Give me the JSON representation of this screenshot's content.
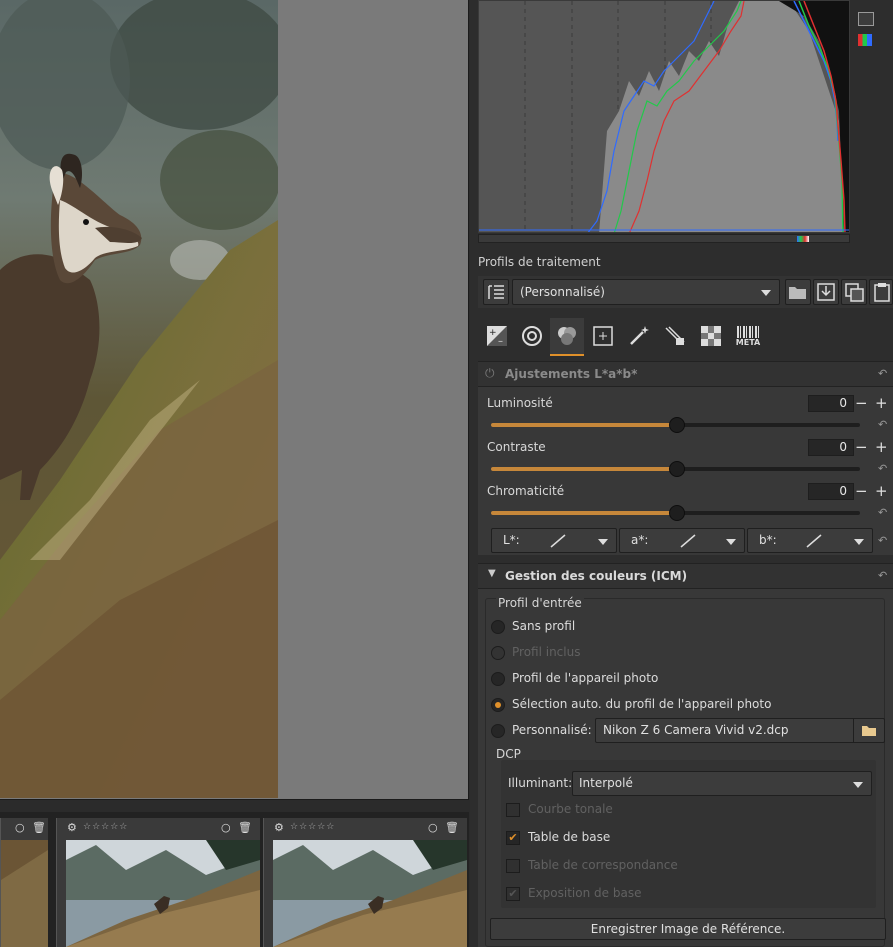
{
  "processing_profiles": {
    "label": "Profils de traitement",
    "selected": "(Personnalisé)"
  },
  "tabs": [
    {
      "name": "exposure-tab",
      "icon": "exposure-icon"
    },
    {
      "name": "detail-tab",
      "icon": "aperture-icon"
    },
    {
      "name": "color-tab",
      "icon": "color-circles-icon",
      "active": true
    },
    {
      "name": "advanced-tab",
      "icon": "crosshair-icon"
    },
    {
      "name": "transform-tab",
      "icon": "magic-wand-icon"
    },
    {
      "name": "raw-tab",
      "icon": "raw-icon"
    },
    {
      "name": "locallab-tab",
      "icon": "checker-icon"
    },
    {
      "name": "metadata-tab",
      "label": "META",
      "icon": "barcode-icon"
    }
  ],
  "lab_adjustments": {
    "title": "Ajustements L*a*b*",
    "sliders": [
      {
        "label": "Luminosité",
        "value": "0",
        "fraction": 0.5
      },
      {
        "label": "Contraste",
        "value": "0",
        "fraction": 0.5
      },
      {
        "label": "Chromaticité",
        "value": "0",
        "fraction": 0.5
      }
    ],
    "curves": [
      "L*:",
      "a*:",
      "b*:"
    ]
  },
  "color_management": {
    "title": "Gestion des couleurs (ICM)",
    "input_profile_label": "Profil d'entrée",
    "options": [
      {
        "label": "Sans profil",
        "selected": false,
        "disabled": false
      },
      {
        "label": "Profil inclus",
        "selected": false,
        "disabled": true
      },
      {
        "label": "Profil de l'appareil photo",
        "selected": false,
        "disabled": false
      },
      {
        "label": "Sélection auto. du profil de l'appareil photo",
        "selected": true,
        "disabled": false
      },
      {
        "label": "Personnalisé:",
        "selected": false,
        "disabled": false
      }
    ],
    "custom_profile_file": "Nikon Z 6 Camera Vivid v2.dcp",
    "dcp": {
      "label": "DCP",
      "illuminant_label": "Illuminant:",
      "illuminant_value": "Interpolé",
      "checks": [
        {
          "label": "Courbe tonale",
          "checked": false,
          "disabled": true
        },
        {
          "label": "Table de base",
          "checked": true,
          "disabled": false
        },
        {
          "label": "Table de correspondance",
          "checked": false,
          "disabled": true
        },
        {
          "label": "Exposition de base",
          "checked": true,
          "disabled": true
        }
      ]
    },
    "save_reference_button": "Enregistrer Image de Référence."
  },
  "filmstrip": {
    "thumbnails": [
      {
        "stars": "☆☆☆☆☆"
      },
      {
        "stars": "☆☆☆☆☆"
      }
    ]
  }
}
